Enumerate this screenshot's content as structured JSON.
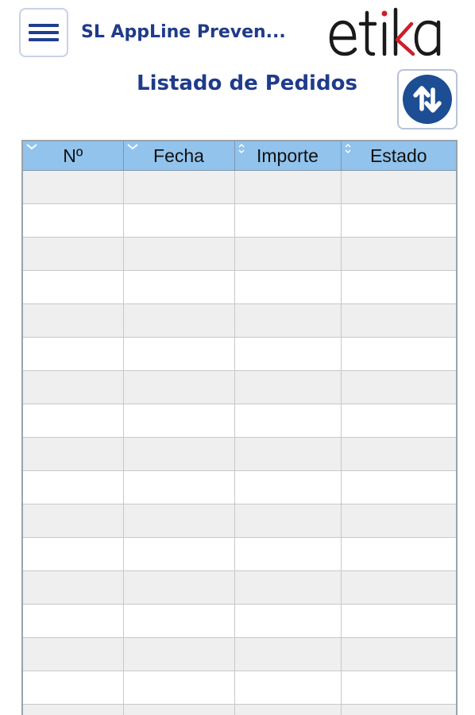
{
  "header": {
    "app_title": "SL AppLine Preven...",
    "logo_text": "etika",
    "menu_icon": "hamburger-menu-icon"
  },
  "page": {
    "title": "Listado de Pedidos",
    "sort_icon": "sort-arrows-icon"
  },
  "colors": {
    "title_blue": "#1f3b8a",
    "header_blue": "#91c3ec",
    "row_alt": "#efefef",
    "logo_red": "#cc1f2d"
  },
  "table": {
    "columns": [
      {
        "label": "Nº",
        "sort_icon": "chevron-down-icon"
      },
      {
        "label": "Fecha",
        "sort_icon": "chevron-down-icon"
      },
      {
        "label": "Importe",
        "sort_icon": "sort-updown-icon"
      },
      {
        "label": "Estado",
        "sort_icon": "sort-updown-icon"
      }
    ],
    "rows": [
      [
        "",
        "",
        "",
        ""
      ],
      [
        "",
        "",
        "",
        ""
      ],
      [
        "",
        "",
        "",
        ""
      ],
      [
        "",
        "",
        "",
        ""
      ],
      [
        "",
        "",
        "",
        ""
      ],
      [
        "",
        "",
        "",
        ""
      ],
      [
        "",
        "",
        "",
        ""
      ],
      [
        "",
        "",
        "",
        ""
      ],
      [
        "",
        "",
        "",
        ""
      ],
      [
        "",
        "",
        "",
        ""
      ],
      [
        "",
        "",
        "",
        ""
      ],
      [
        "",
        "",
        "",
        ""
      ],
      [
        "",
        "",
        "",
        ""
      ],
      [
        "",
        "",
        "",
        ""
      ],
      [
        "",
        "",
        "",
        ""
      ],
      [
        "",
        "",
        "",
        ""
      ],
      [
        "",
        "",
        "",
        ""
      ]
    ]
  }
}
